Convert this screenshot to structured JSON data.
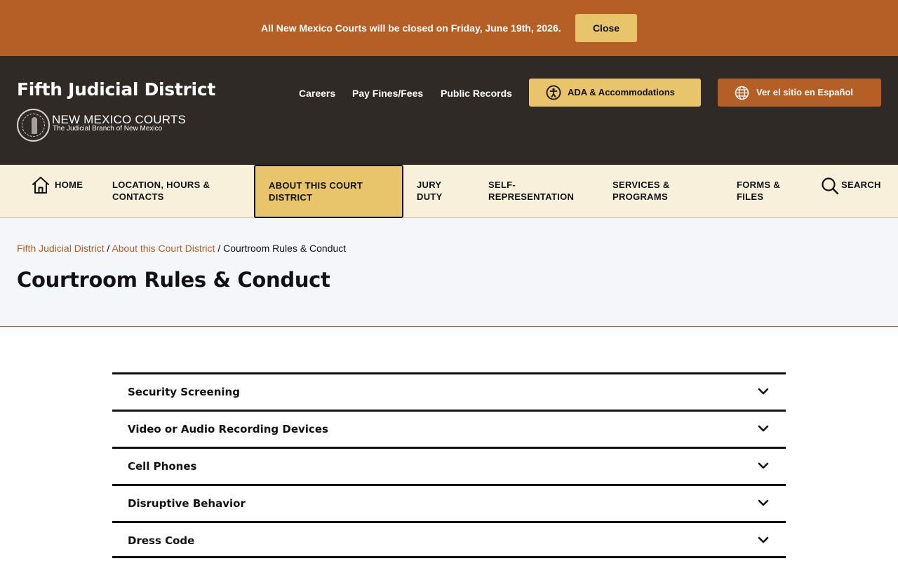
{
  "alert": {
    "message": "All New Mexico Courts will be closed on Friday, June 19th, 2026.",
    "close_label": "Close"
  },
  "header": {
    "site_title": "Fifth Judicial District",
    "org_name": "NEW MEXICO COURTS",
    "org_tagline": "The Judicial Branch of New Mexico",
    "links": [
      "Careers",
      "Pay Fines/Fees",
      "Public Records"
    ],
    "ada_label": "ADA & Accommodations",
    "spanish_label": "Ver el sitio en Español"
  },
  "nav": {
    "home": "HOME",
    "location_1": "LOCATION, HOURS &",
    "location_2": "CONTACTS",
    "about_1": "ABOUT THIS COURT",
    "about_2": "DISTRICT",
    "jury_1": "JURY",
    "jury_2": "DUTY",
    "self_1": "SELF-",
    "self_2": "REPRESENTATION",
    "services_1": "SERVICES &",
    "services_2": "PROGRAMS",
    "forms_1": "FORMS &",
    "forms_2": "FILES",
    "search": "SEARCH"
  },
  "breadcrumb": {
    "crumb_1": "Fifth Judicial District",
    "crumb_2": "About this Court District",
    "current": "Courtroom Rules & Conduct",
    "separator": " / "
  },
  "page": {
    "title": "Courtroom Rules & Conduct"
  },
  "accordion": [
    "Security Screening",
    "Video or Audio Recording Devices",
    "Cell Phones",
    "Disruptive Behavior",
    "Dress Code"
  ],
  "colors": {
    "brand_orange": "#b55f27",
    "gold": "#e8c46a",
    "header_dark": "#302a26",
    "nav_bg": "#f9f0dc"
  }
}
